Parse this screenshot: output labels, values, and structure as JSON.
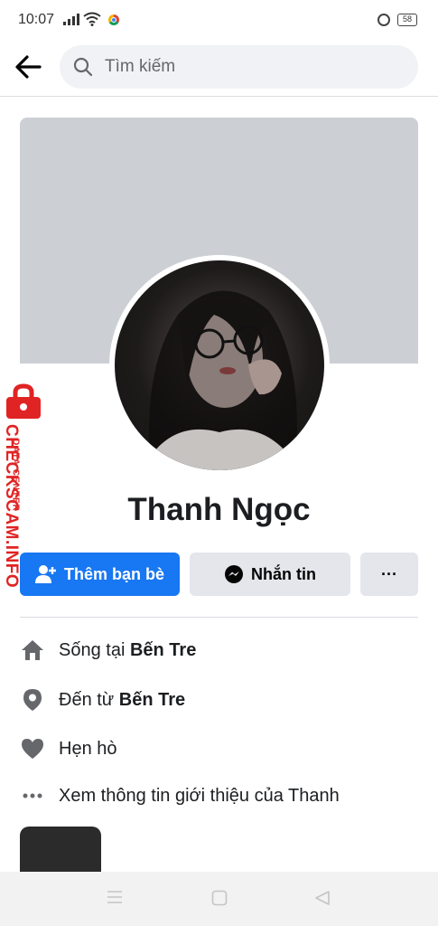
{
  "status_bar": {
    "time": "10:07",
    "battery": "58"
  },
  "search": {
    "placeholder": "Tìm kiếm"
  },
  "profile": {
    "name": "Thanh Ngọc"
  },
  "actions": {
    "add_friend": "Thêm bạn bè",
    "message": "Nhắn tin",
    "more": "···"
  },
  "info": {
    "lives_prefix": "Sống tại ",
    "lives_place": "Bến Tre",
    "from_prefix": "Đến từ ",
    "from_place": "Bến Tre",
    "dating": "Hẹn hò",
    "see_about": "Xem thông tin giới thiệu của Thanh"
  },
  "watermark": {
    "line1": "DATA CENTER",
    "line2": "CHECKSCAM.INFO"
  },
  "colors": {
    "primary": "#1877f2",
    "secondary_btn": "#e4e6eb",
    "cover": "#ccd0d5",
    "watermark": "#e02424"
  }
}
